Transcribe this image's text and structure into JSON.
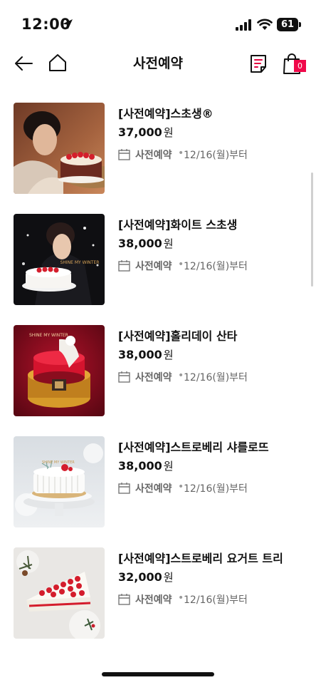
{
  "status_bar": {
    "time": "12:00",
    "battery": "61"
  },
  "header": {
    "title": "사전예약",
    "cart_count": "0"
  },
  "products": [
    {
      "name": "[사전예약]스초생®",
      "price": "37,000",
      "currency": "원",
      "tag": "사전예약",
      "availability": "12/16(월)부터"
    },
    {
      "name": "[사전예약]화이트 스초생",
      "price": "38,000",
      "currency": "원",
      "tag": "사전예약",
      "availability": "12/16(월)부터"
    },
    {
      "name": "[사전예약]홀리데이 산타",
      "price": "38,000",
      "currency": "원",
      "tag": "사전예약",
      "availability": "12/16(월)부터"
    },
    {
      "name": "[사전예약]스트로베리 샤를로뜨",
      "price": "38,000",
      "currency": "원",
      "tag": "사전예약",
      "availability": "12/16(월)부터"
    },
    {
      "name": "[사전예약]스트로베리 요거트 트리",
      "price": "32,000",
      "currency": "원",
      "tag": "사전예약",
      "availability": "12/16(월)부터"
    }
  ],
  "dot_separator": "•",
  "image_text": {
    "shine_my_winter": "SHINE MY WINTER"
  }
}
